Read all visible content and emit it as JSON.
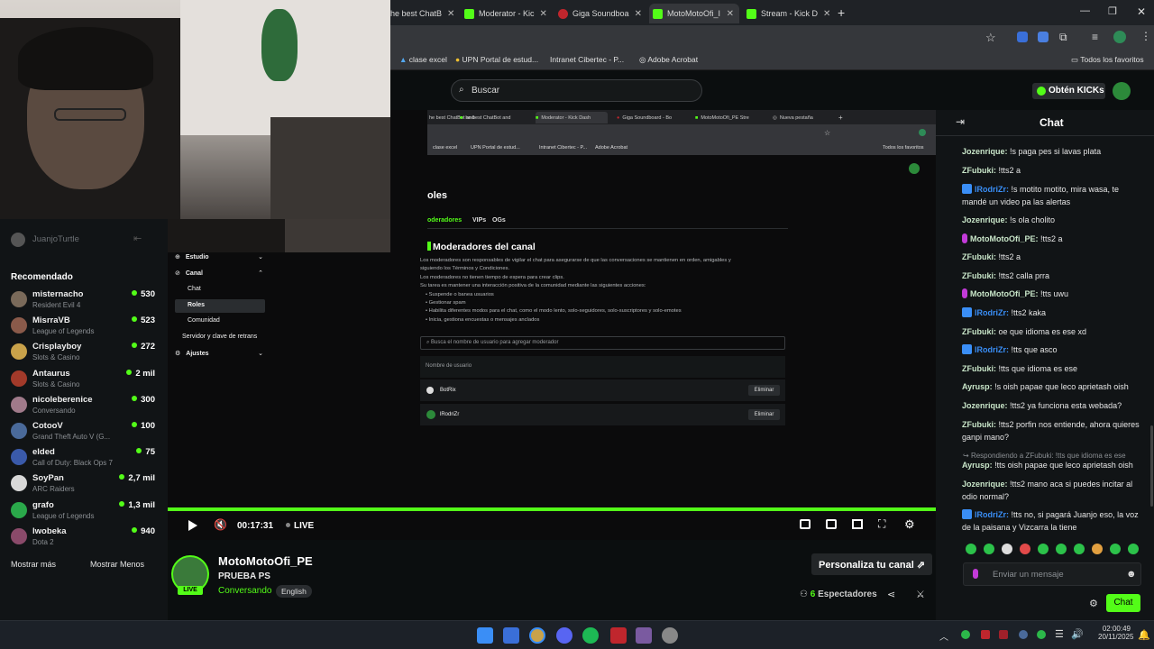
{
  "browser": {
    "tabs": [
      {
        "label": "he best ChatB"
      },
      {
        "label": "Moderator - Kic"
      },
      {
        "label": "Giga Soundboa"
      },
      {
        "label": "MotoMotoOfi_I"
      },
      {
        "label": "Stream - Kick D"
      }
    ],
    "bookmarks": [
      "clase excel",
      "UPN Portal de estud...",
      "Intranet Cibertec - P...",
      "Adobe Acrobat"
    ],
    "all_bookmarks": "Todos los favoritos"
  },
  "header": {
    "search_placeholder": "Buscar",
    "get_kicks": "Obtén KICKs"
  },
  "sidebar": {
    "following": "JuanjoTurtle",
    "recommended_title": "Recomendado",
    "items": [
      {
        "name": "misternacho",
        "game": "Resident Evil 4",
        "viewers": "530",
        "color": "#7a6a5a"
      },
      {
        "name": "MisrraVB",
        "game": "League of Legends",
        "viewers": "523",
        "color": "#8a5a4a"
      },
      {
        "name": "Crisplayboy",
        "game": "Slots & Casino",
        "viewers": "272",
        "color": "#c9a24a"
      },
      {
        "name": "Antaurus",
        "game": "Slots & Casino",
        "viewers": "2 mil",
        "color": "#a33a2a"
      },
      {
        "name": "nicoleberenice",
        "game": "Conversando",
        "viewers": "300",
        "color": "#a07a8a"
      },
      {
        "name": "CotooV",
        "game": "Grand Theft Auto V (G...",
        "viewers": "100",
        "color": "#4a6a9a"
      },
      {
        "name": "elded",
        "game": "Call of Duty: Black Ops 7",
        "viewers": "75",
        "color": "#3a5aaa"
      },
      {
        "name": "SoyPan",
        "game": "ARC Raiders",
        "viewers": "2,7 mil",
        "color": "#d8d8d8"
      },
      {
        "name": "grafo",
        "game": "League of Legends",
        "viewers": "1,3 mil",
        "color": "#2aa84a"
      },
      {
        "name": "lwobeka",
        "game": "Dota 2",
        "viewers": "940",
        "color": "#8a4a6a"
      }
    ],
    "show_more": "Mostrar más",
    "show_less": "Mostrar Menos"
  },
  "stream_content": {
    "inner_tabs": [
      "he best ChatBot and",
      "Moderator - Kick Dash",
      "Giga Soundboard - Bo",
      "MotoMotoOfi_PE Stre",
      "Nueva pestaña"
    ],
    "inner_bookmarks": [
      "clase excel",
      "UPN Portal de estud...",
      "Intranet Cibertec - P...",
      "Adobe Acrobat"
    ],
    "inner_all_bookmarks": "Todos los favoritos",
    "nav": {
      "estudio": "Estudio",
      "canal": "Canal",
      "chat": "Chat",
      "roles": "Roles",
      "comunidad": "Comunidad",
      "servidor": "Servidor y clave de retrans",
      "ajustes": "Ajustes"
    },
    "page_title": "oles",
    "role_tabs": [
      "oderadores",
      "VIPs",
      "OGs"
    ],
    "section_title": "Moderadores del canal",
    "desc": [
      "Los moderadores son responsables de vigilar el chat para asegurarse de que las conversaciones se mantienen en orden, amigables y",
      "siguiendo los Términos y Condiciones.",
      "Los moderadores no tienen tiempo de espera para crear clips.",
      "Su tarea es mantener una interacción positiva de la comunidad mediante las siguientes acciones:",
      "• Suspende o banea usuarios",
      "• Gestionar spam",
      "• Habilita diferentes modos para el chat, como el modo lento, solo-seguidores, solo-suscriptores y solo-emotes",
      "• Inicia, gestiona encuestas o mensajes anclados"
    ],
    "search_mod": "Busca el nombre de usuario para agregar moderador",
    "col_header": "Nombre de usuario",
    "mods": [
      {
        "name": "BotRix",
        "action": "Eliminar"
      },
      {
        "name": "lRodriZr",
        "action": "Eliminar"
      }
    ]
  },
  "player": {
    "time": "00:17:31",
    "live": "LIVE"
  },
  "stream_info": {
    "channel": "MotoMotoOfi_PE",
    "title": "PRUEBA PS",
    "category": "Conversando",
    "language": "English",
    "live_badge": "LIVE",
    "customize": "Personaliza tu canal",
    "viewers_count": "6",
    "viewers_label": "Espectadores"
  },
  "chat": {
    "title": "Chat",
    "messages": [
      {
        "user": "Jozenrique:",
        "text": " !s paga pes si lavas plata",
        "color": "#c9e6c9"
      },
      {
        "user": "ZFubuki:",
        "text": " !tts2 a",
        "color": "#c9e6c9"
      },
      {
        "user": "lRodriZr:",
        "text": " !s motito motito, mira wasa, te mandé un video pa las alertas",
        "color": "#3a8ef6"
      },
      {
        "user": "Jozenrique:",
        "text": " !s ola cholito",
        "color": "#c9e6c9"
      },
      {
        "user": "MotoMotoOfi_PE:",
        "text": " !tts2 a",
        "color": "#c9e6c9"
      },
      {
        "user": "ZFubuki:",
        "text": " !tts2 a",
        "color": "#c9e6c9"
      },
      {
        "user": "ZFubuki:",
        "text": " !tts2 calla prra",
        "color": "#c9e6c9"
      },
      {
        "user": "MotoMotoOfi_PE:",
        "text": " !tts uwu",
        "color": "#c9e6c9"
      },
      {
        "user": "lRodriZr:",
        "text": " !tts2 kaka",
        "color": "#3a8ef6"
      },
      {
        "user": "ZFubuki:",
        "text": " oe que idioma es ese xd",
        "color": "#c9e6c9"
      },
      {
        "user": "lRodriZr:",
        "text": " !tts que asco",
        "color": "#3a8ef6"
      },
      {
        "user": "ZFubuki:",
        "text": " !tts que idioma es ese",
        "color": "#c9e6c9"
      },
      {
        "user": "Ayrusp:",
        "text": " !s oish papae que leco aprietash oish",
        "color": "#c9e6c9"
      },
      {
        "user": "Jozenrique:",
        "text": " !tts2 ya funciona esta webada?",
        "color": "#c9e6c9"
      },
      {
        "user": "ZFubuki:",
        "text": " !tts2 porfin nos entiende, ahora quieres ganpi mano?",
        "color": "#c9e6c9"
      },
      {
        "user": "Ayrusp:",
        "text": " !tts oish papae que leco aprietash oish",
        "color": "#c9e6c9"
      },
      {
        "user": "Jozenrique:",
        "text": " !tts2 mano aca si puedes incitar al odio normal?",
        "color": "#c9e6c9"
      },
      {
        "user": "lRodriZr:",
        "text": " !tts no, si pagará Juanjo eso, la voz de la paisana y Vizcarra la tiene",
        "color": "#3a8ef6"
      }
    ],
    "reply_note": "Respondiendo a ZFubuki: !tts que idioma es ese",
    "input_placeholder": "Enviar un mensaje",
    "send_label": "Chat"
  },
  "taskbar": {
    "time": "02:00:49",
    "date": "20/11/2025"
  },
  "colors": {
    "accent": "#53fc18",
    "chat_bg": "#111416"
  }
}
